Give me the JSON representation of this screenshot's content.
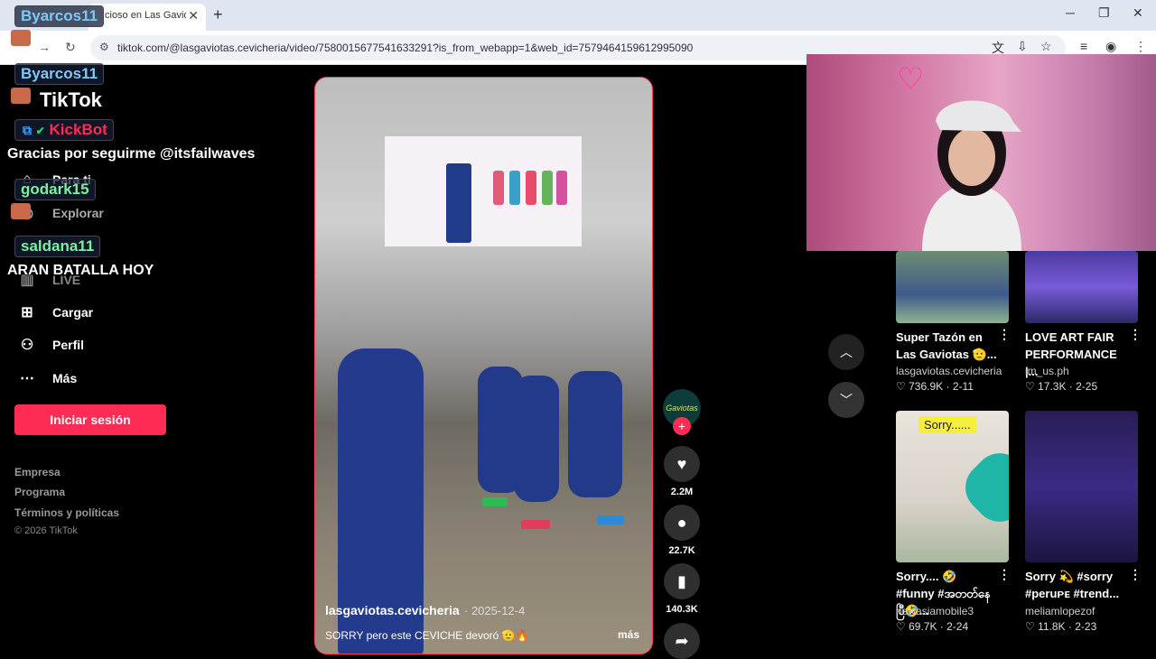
{
  "browser": {
    "tab_title": "cioso en Las Gaviot",
    "url": "tiktok.com/@lasgaviotas.cevicheria/video/7580015677541633291?is_from_webapp=1&web_id=7579464159612995090"
  },
  "tiktok": {
    "logo": "TikTok",
    "nav": {
      "para_ti": "Para ti",
      "explorar": "Explorar",
      "live": "LIVE",
      "cargar": "Cargar",
      "perfil": "Perfil",
      "mas": "Más"
    },
    "login_button": "Iniciar sesión",
    "footer": {
      "empresa": "Empresa",
      "programa": "Programa",
      "terminos": "Términos y políticas",
      "copyright": "© 2026 TikTok"
    }
  },
  "video": {
    "author": "lasgaviotas.cevicheria",
    "date": "· 2025-12-4",
    "caption": "SORRY pero este CEVICHE devoró 🫡🔥",
    "more": "más",
    "avatar_text": "Gaviotas",
    "likes": "2.2M",
    "comments": "22.7K",
    "saves": "140.3K"
  },
  "recommended": [
    {
      "title": "Super Tazón en Las Gaviotas 🫡...",
      "author": "lasgaviotas.cevicheria",
      "likes": "736.9K",
      "date": "2-11"
    },
    {
      "title": "LOVE ART FAIR PERFORMANCE |...",
      "author": "im_us.ph",
      "likes": "17.3K",
      "date": "2-25"
    },
    {
      "title": "Sorry.... 🤣 #funny #အတတ်နေပြီ🤣...",
      "author": "newasiamobile3",
      "likes": "69.7K",
      "date": "2-24",
      "thumb_label": "Sorry......"
    },
    {
      "title": "Sorry 💫 #sorry #peruᴘᴇ #trend...",
      "author": "meliamlopezof",
      "likes": "11.8K",
      "date": "2-23"
    }
  ],
  "overlay": {
    "chat": [
      {
        "user": "Byarcos11",
        "message": ""
      },
      {
        "user": "Byarcos11",
        "message": ""
      },
      {
        "user": "KickBot",
        "message": "Gracias por seguirme @itsfailwaves"
      },
      {
        "user": "godark15",
        "message": ""
      },
      {
        "user": "saldana11",
        "message": "ARAN BATALLA HOY"
      }
    ]
  },
  "colors": {
    "accent": "#fe2c55",
    "kickbot": "#ff2d55",
    "username_blue": "#7ec8ff",
    "username_green": "#7cf0a0"
  }
}
